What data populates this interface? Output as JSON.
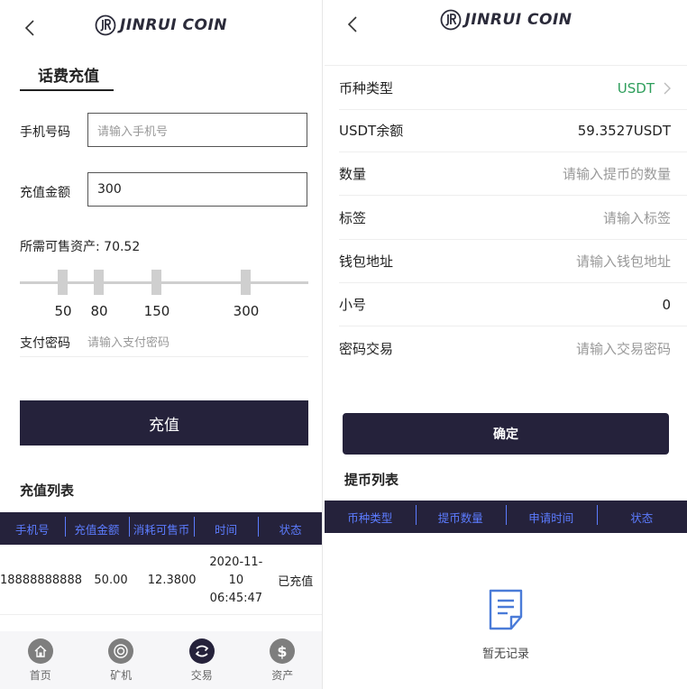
{
  "brand": {
    "logo_text": "JINRUI COIN",
    "accent": "#25223b",
    "link_blue": "#5c7cff",
    "green": "#2e9e5b"
  },
  "recharge": {
    "tab_title": "话费充值",
    "phone": {
      "label": "手机号码",
      "placeholder": "请输入手机号"
    },
    "amount": {
      "label": "充值金额",
      "value": "300"
    },
    "need_asset": "所需可售资产: 70.52",
    "slider_ticks": [
      "50",
      "80",
      "150",
      "300"
    ],
    "password": {
      "label": "支付密码",
      "placeholder": "请输入支付密码"
    },
    "submit_label": "充值",
    "list_title": "充值列表",
    "table": {
      "headers": [
        "手机号",
        "充值金额",
        "消耗可售币",
        "时间",
        "状态"
      ],
      "rows": [
        {
          "phone": "18888888888",
          "amount": "50.00",
          "coins": "12.3800",
          "date": "2020-11-10",
          "time": "06:45:47",
          "status": "已充值"
        }
      ]
    }
  },
  "nav": {
    "items": [
      {
        "label": "首页",
        "icon": "home-icon"
      },
      {
        "label": "矿机",
        "icon": "miner-icon"
      },
      {
        "label": "交易",
        "icon": "trade-icon",
        "active": true
      },
      {
        "label": "资产",
        "icon": "assets-icon"
      }
    ]
  },
  "withdraw": {
    "rows": [
      {
        "label": "币种类型",
        "value": "USDT"
      },
      {
        "label": "USDT余额",
        "value": "59.3527USDT"
      },
      {
        "label": "数量",
        "value": "请输入提币的数量"
      },
      {
        "label": "标签",
        "value": "请输入标签"
      },
      {
        "label": "钱包地址",
        "value": "请输入钱包地址"
      },
      {
        "label": "小号",
        "value": "0"
      },
      {
        "label": "密码交易",
        "value": "请输入交易密码"
      }
    ],
    "confirm_label": "确定",
    "list_title": "提币列表",
    "table_headers": [
      "币种类型",
      "提币数量",
      "申请时间",
      "状态"
    ],
    "empty_text": "暂无记录"
  }
}
